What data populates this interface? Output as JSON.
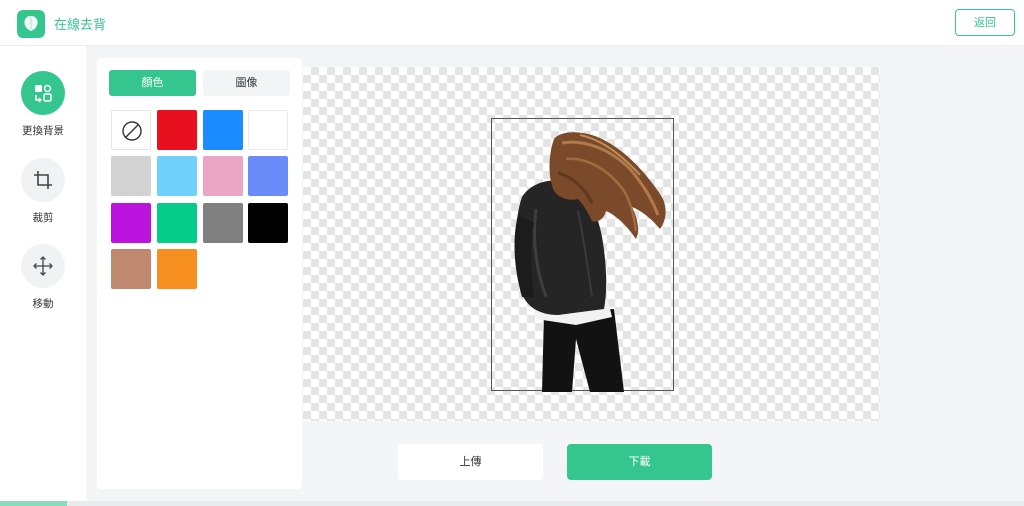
{
  "header": {
    "app_title": "在線去背",
    "back_label": "返回",
    "logo_icon": "balloon-icon"
  },
  "toolbar": {
    "items": [
      {
        "label": "更換背景",
        "icon": "change-background-icon",
        "active": true
      },
      {
        "label": "裁剪",
        "icon": "crop-icon",
        "active": false
      },
      {
        "label": "移動",
        "icon": "move-icon",
        "active": false
      }
    ]
  },
  "panel": {
    "tabs": [
      {
        "label": "顏色",
        "active": true
      },
      {
        "label": "圖像",
        "active": false
      }
    ],
    "swatches": [
      {
        "name": "none",
        "color": "none"
      },
      {
        "name": "red",
        "color": "#e8101e"
      },
      {
        "name": "blue",
        "color": "#1a8cff"
      },
      {
        "name": "white",
        "color": "#ffffff"
      },
      {
        "name": "light-gray",
        "color": "#d2d2d2"
      },
      {
        "name": "sky-blue",
        "color": "#6fd1fb"
      },
      {
        "name": "pink",
        "color": "#eca6c5"
      },
      {
        "name": "periwinkle",
        "color": "#6a8cfa"
      },
      {
        "name": "purple",
        "color": "#bb14de"
      },
      {
        "name": "green",
        "color": "#06cc8a"
      },
      {
        "name": "gray",
        "color": "#808080"
      },
      {
        "name": "black",
        "color": "#000000"
      },
      {
        "name": "brown",
        "color": "#c18870"
      },
      {
        "name": "orange",
        "color": "#f68f1f"
      }
    ]
  },
  "actions": {
    "upload_label": "上傳",
    "download_label": "下載"
  },
  "progress": {
    "value": 0.065
  },
  "colors": {
    "accent": "#35c68f"
  }
}
